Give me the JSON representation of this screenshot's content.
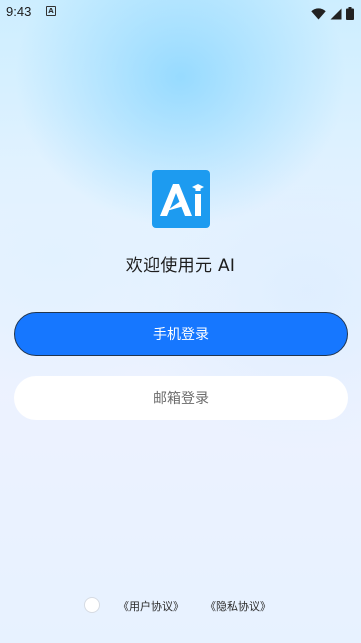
{
  "status_bar": {
    "time": "9:43",
    "app_icon_glyph": "A",
    "icons": [
      "wifi-icon",
      "signal-icon",
      "battery-icon"
    ]
  },
  "logo": {
    "text": "Ai",
    "color": "#1d9bf0",
    "badge_icon": "graduation-cap-icon"
  },
  "welcome_text": "欢迎使用元 AI",
  "buttons": {
    "phone_login": "手机登录",
    "email_login": "邮箱登录"
  },
  "agreement": {
    "user_agreement": "《用户协议》",
    "privacy_policy": "《隐私协议》",
    "checked": false
  },
  "colors": {
    "primary": "#1677ff",
    "logo_bg": "#1d9bf0"
  }
}
